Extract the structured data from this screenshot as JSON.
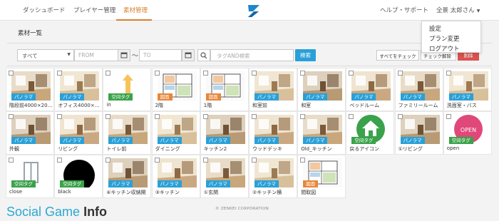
{
  "nav": {
    "items": [
      "ダッシュボード",
      "プレイヤー管理",
      "素材管理"
    ],
    "help": "ヘルプ・サポート",
    "user": "全景 太郎さん"
  },
  "dropdown": [
    "設定",
    "プラン変更",
    "ログアウト"
  ],
  "page": {
    "title": "素材一覧"
  },
  "filter": {
    "type_value": "すべて",
    "from_placeholder": "FROM",
    "tilde": "〜",
    "to_placeholder": "TO",
    "search_placeholder": "タグAND検索",
    "search_button": "検索",
    "check_all": "すべてをチェック",
    "uncheck": "チェック解除",
    "delete": "削除"
  },
  "tags": {
    "pano": "パノラマ",
    "empty": "空间タグ",
    "floor": "図面"
  },
  "items": [
    {
      "caption": "階段前4000×20…",
      "tag": "pano",
      "icon": "stairs-photo"
    },
    {
      "caption": "オフィス4000×…",
      "tag": "pano",
      "icon": "office-photo"
    },
    {
      "caption": "in",
      "tag": "empty",
      "icon": "arrow-up-icon"
    },
    {
      "caption": "2階",
      "tag": "floor",
      "icon": "floorplan-image"
    },
    {
      "caption": "1階",
      "tag": "floor",
      "icon": "floorplan-image"
    },
    {
      "caption": "和室前",
      "tag": "pano",
      "icon": "room-photo"
    },
    {
      "caption": "和室",
      "tag": "pano",
      "icon": "room-photo"
    },
    {
      "caption": "ベッドルーム",
      "tag": "pano",
      "icon": "room-photo"
    },
    {
      "caption": "ファミリールーム",
      "tag": "pano",
      "icon": "room-photo"
    },
    {
      "caption": "洗面室・バス",
      "tag": "pano",
      "icon": "room-photo"
    },
    {
      "caption": "外観",
      "tag": "pano",
      "icon": "exterior-photo"
    },
    {
      "caption": "リビング",
      "tag": "pano",
      "icon": "room-photo"
    },
    {
      "caption": "トイレ前",
      "tag": "pano",
      "icon": "room-photo"
    },
    {
      "caption": "ダイニング",
      "tag": "pano",
      "icon": "room-photo"
    },
    {
      "caption": "キッチン2",
      "tag": "pano",
      "icon": "room-photo"
    },
    {
      "caption": "ウッドデッキ",
      "tag": "pano",
      "icon": "room-photo"
    },
    {
      "caption": "Old_キッチン",
      "tag": "pano",
      "icon": "room-photo"
    },
    {
      "caption": "戻るアイコン",
      "tag": "empty",
      "icon": "home-icon"
    },
    {
      "caption": "①リビング",
      "tag": "pano",
      "icon": "room-photo"
    },
    {
      "caption": "open",
      "tag": "empty",
      "icon": "open-icon"
    },
    {
      "caption": "close",
      "tag": "empty",
      "icon": "close-icon"
    },
    {
      "caption": "black",
      "tag": "empty",
      "icon": "black-circle-icon"
    },
    {
      "caption": "④キッチン収納開",
      "tag": "pano",
      "icon": "room-photo"
    },
    {
      "caption": "③キッチン",
      "tag": "pano",
      "icon": "room-photo"
    },
    {
      "caption": "①玄関",
      "tag": "pano",
      "icon": "room-photo"
    },
    {
      "caption": "②キッチン横",
      "tag": "pano",
      "icon": "room-photo"
    },
    {
      "caption": "間取図",
      "tag": "floor",
      "icon": "floorplan-image"
    }
  ],
  "footer": {
    "copyright": "© ZENKEI CORPORATION"
  },
  "watermark": {
    "prefix": "Social Game",
    "suffix": "Info"
  },
  "colors": {
    "accent": "#d9822b",
    "primary": "#2aa0d8",
    "danger": "#d9534f",
    "empty_tag": "#3aa24a"
  }
}
